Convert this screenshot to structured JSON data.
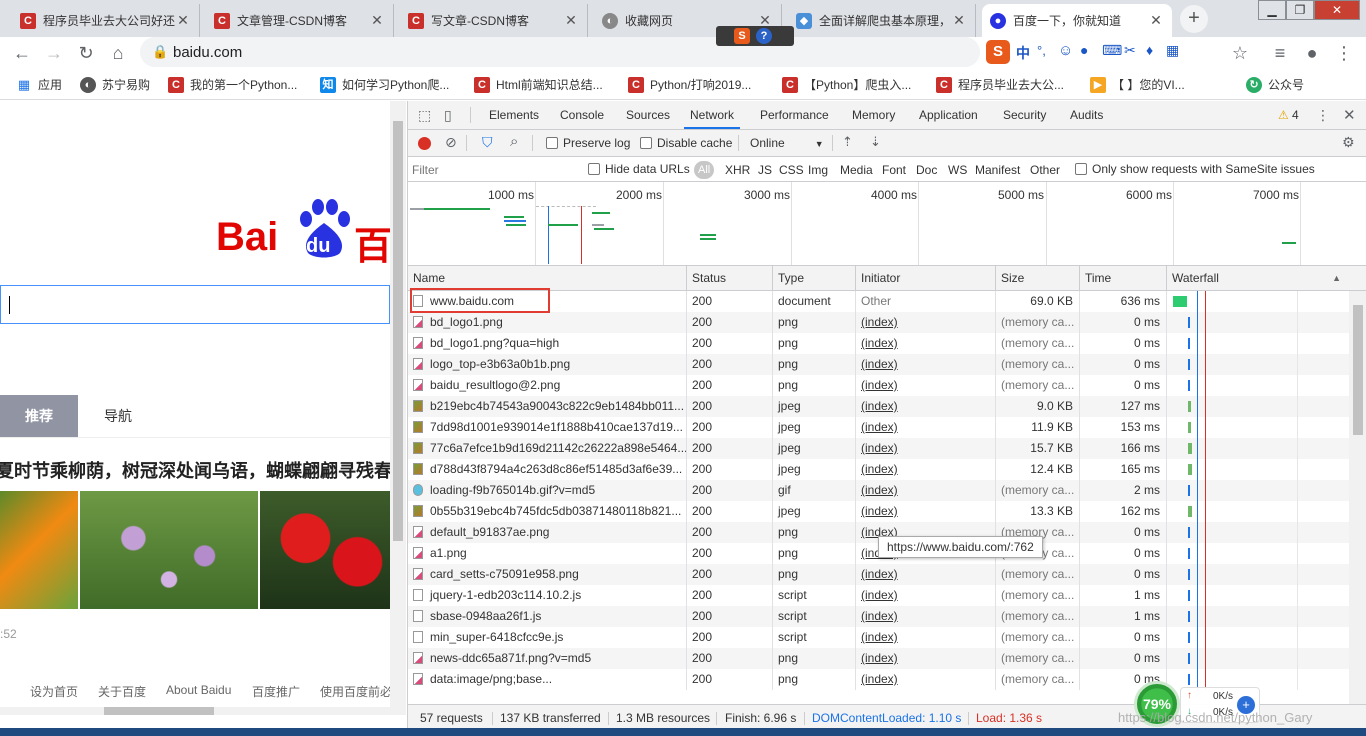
{
  "tabs": [
    {
      "title": "程序员毕业去大公司好还",
      "icon": "csdn-icon"
    },
    {
      "title": "文章管理-CSDN博客",
      "icon": "csdn-icon"
    },
    {
      "title": "写文章-CSDN博客",
      "icon": "csdn-icon"
    },
    {
      "title": "收藏网页",
      "icon": "globe-icon"
    },
    {
      "title": "全面详解爬虫基本原理，",
      "icon": "shield-icon"
    },
    {
      "title": "百度一下，你就知道",
      "icon": "baidu-paw-icon"
    }
  ],
  "toolbar": {
    "url": "baidu.com",
    "ime_label": "中",
    "ime_punct": "°,"
  },
  "bookmarks": [
    {
      "label": "应用",
      "icon": "apps-grid-icon"
    },
    {
      "label": "苏宁易购",
      "icon": "globe-icon"
    },
    {
      "label": "我的第一个Python...",
      "icon": "csdn-icon"
    },
    {
      "label": "如何学习Python爬...",
      "icon": "zhihu-icon"
    },
    {
      "label": "Html前端知识总结...",
      "icon": "csdn-icon"
    },
    {
      "label": "Python/打响2019...",
      "icon": "csdn-icon"
    },
    {
      "label": "【Python】爬虫入...",
      "icon": "csdn-icon"
    },
    {
      "label": "程序员毕业去大公...",
      "icon": "csdn-icon"
    },
    {
      "label": "【       】您的VI...",
      "icon": "video-icon"
    },
    {
      "label": "公众号",
      "icon": "wechat-icon"
    }
  ],
  "page": {
    "logo_text_bai": "Bai",
    "logo_text_du": "du",
    "logo_text_baidu_cn": "百",
    "nav_tabs": [
      "推荐",
      "导航"
    ],
    "headline": "夏时节乘柳荫，树冠深处闻乌语，蝴蝶翩翩寻残春",
    "time": ":52",
    "footer_links": [
      "设为首页",
      "关于百度",
      "About Baidu",
      "百度推广",
      "使用百度前必"
    ]
  },
  "devtools": {
    "panels": [
      "Elements",
      "Console",
      "Sources",
      "Network",
      "Performance",
      "Memory",
      "Application",
      "Security",
      "Audits"
    ],
    "active_panel": "Network",
    "warning_count": "4",
    "preserve_log": "Preserve log",
    "disable_cache": "Disable cache",
    "throttle": "Online",
    "filter_placeholder": "Filter",
    "hide_data_urls": "Hide data URLs",
    "type_filters": [
      "All",
      "XHR",
      "JS",
      "CSS",
      "Img",
      "Media",
      "Font",
      "Doc",
      "WS",
      "Manifest",
      "Other"
    ],
    "samesite": "Only show requests with SameSite issues",
    "timeline_ticks": [
      "1000 ms",
      "2000 ms",
      "3000 ms",
      "4000 ms",
      "5000 ms",
      "6000 ms",
      "7000 ms"
    ],
    "columns": [
      "Name",
      "Status",
      "Type",
      "Initiator",
      "Size",
      "Time",
      "Waterfall"
    ],
    "rows": [
      {
        "name": "www.baidu.com",
        "status": "200",
        "type": "document",
        "initiator": "Other",
        "size": "69.0 KB",
        "time": "636 ms",
        "icon": "document-icon"
      },
      {
        "name": "bd_logo1.png",
        "status": "200",
        "type": "png",
        "initiator": "(index)",
        "size": "(memory ca...",
        "time": "0 ms",
        "icon": "image-file-icon"
      },
      {
        "name": "bd_logo1.png?qua=high",
        "status": "200",
        "type": "png",
        "initiator": "(index)",
        "size": "(memory ca...",
        "time": "0 ms",
        "icon": "image-file-icon"
      },
      {
        "name": "logo_top-e3b63a0b1b.png",
        "status": "200",
        "type": "png",
        "initiator": "(index)",
        "size": "(memory ca...",
        "time": "0 ms",
        "icon": "image-file-icon"
      },
      {
        "name": "baidu_resultlogo@2.png",
        "status": "200",
        "type": "png",
        "initiator": "(index)",
        "size": "(memory ca...",
        "time": "0 ms",
        "icon": "image-file-icon"
      },
      {
        "name": "b219ebc4b74543a90043c822c9eb1484bb011...",
        "status": "200",
        "type": "jpeg",
        "initiator": "(index)",
        "size": "9.0 KB",
        "time": "127 ms",
        "icon": "photo-thumb-icon"
      },
      {
        "name": "7dd98d1001e939014e1f1888b410cae137d19...",
        "status": "200",
        "type": "jpeg",
        "initiator": "(index)",
        "size": "11.9 KB",
        "time": "153 ms",
        "icon": "photo-thumb-icon"
      },
      {
        "name": "77c6a7efce1b9d169d21142c26222a898e5464...",
        "status": "200",
        "type": "jpeg",
        "initiator": "(index)",
        "size": "15.7 KB",
        "time": "166 ms",
        "icon": "photo-thumb-icon"
      },
      {
        "name": "d788d43f8794a4c263d8c86ef51485d3af6e39...",
        "status": "200",
        "type": "jpeg",
        "initiator": "(index)",
        "size": "12.4 KB",
        "time": "165 ms",
        "icon": "photo-thumb-icon"
      },
      {
        "name": "loading-f9b765014b.gif?v=md5",
        "status": "200",
        "type": "gif",
        "initiator": "(index)",
        "size": "(memory ca...",
        "time": "2 ms",
        "icon": "gif-file-icon"
      },
      {
        "name": "0b55b319ebc4b745fdc5db03871480118b821...",
        "status": "200",
        "type": "jpeg",
        "initiator": "(index)",
        "size": "13.3 KB",
        "time": "162 ms",
        "icon": "photo-thumb-icon"
      },
      {
        "name": "default_b91837ae.png",
        "status": "200",
        "type": "png",
        "initiator": "(index)",
        "size": "(memory ca...",
        "time": "0 ms",
        "icon": "image-file-icon"
      },
      {
        "name": "a1.png",
        "status": "200",
        "type": "png",
        "initiator": "(index)",
        "size": "(memory ca...",
        "time": "0 ms",
        "icon": "image-file-icon"
      },
      {
        "name": "card_setts-c75091e958.png",
        "status": "200",
        "type": "png",
        "initiator": "(index)",
        "size": "(memory ca...",
        "time": "0 ms",
        "icon": "image-file-icon"
      },
      {
        "name": "jquery-1-edb203c114.10.2.js",
        "status": "200",
        "type": "script",
        "initiator": "(index)",
        "size": "(memory ca...",
        "time": "1 ms",
        "icon": "script-file-icon"
      },
      {
        "name": "sbase-0948aa26f1.js",
        "status": "200",
        "type": "script",
        "initiator": "(index)",
        "size": "(memory ca...",
        "time": "1 ms",
        "icon": "script-file-icon"
      },
      {
        "name": "min_super-6418cfcc9e.js",
        "status": "200",
        "type": "script",
        "initiator": "(index)",
        "size": "(memory ca...",
        "time": "0 ms",
        "icon": "script-file-icon"
      },
      {
        "name": "news-ddc65a871f.png?v=md5",
        "status": "200",
        "type": "png",
        "initiator": "(index)",
        "size": "(memory ca...",
        "time": "0 ms",
        "icon": "image-file-icon"
      },
      {
        "name": "data:image/png;base...",
        "status": "200",
        "type": "png",
        "initiator": "(index)",
        "size": "(memory ca...",
        "time": "0 ms",
        "icon": "image-file-icon"
      }
    ],
    "tooltip": "https://www.baidu.com/:762",
    "status": {
      "requests": "57 requests",
      "transferred": "137 KB transferred",
      "resources": "1.3 MB resources",
      "finish": "Finish: 6.96 s",
      "dcl": "DOMContentLoaded: 1.10 s",
      "load": "Load: 1.36 s"
    },
    "colors": {
      "dcl": "#1a73e8",
      "load": "#d93025",
      "accent": "#1a73e8"
    }
  },
  "overlay": {
    "percent": "79%",
    "up_speed": "0K/s",
    "down_speed": "0K/s",
    "watermark": "https://blog.csdn.net/python_Gary"
  }
}
